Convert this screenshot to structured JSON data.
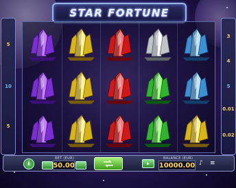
{
  "game": {
    "title": "STAR FORTUNE"
  },
  "paylines": {
    "left": [
      "5",
      "10",
      "5"
    ],
    "right": [
      "3",
      "4",
      "5",
      "0.01",
      "0.02"
    ]
  },
  "reels": [
    [
      "purple-crystal",
      "purple-crystal",
      "purple-crystal"
    ],
    [
      "yellow-crystal",
      "yellow-crystal",
      "yellow-crystal"
    ],
    [
      "red-crystal",
      "red-crystal",
      "red-crystal"
    ],
    [
      "white-crystal",
      "green-crystal",
      "green-crystal"
    ],
    [
      "blue-crystal",
      "blue-crystal",
      "yellow-crystal"
    ]
  ],
  "crystal_colors": {
    "purple-crystal": {
      "light": "#c77dff",
      "mid": "#7b2fd0",
      "dark": "#3e0e7a"
    },
    "yellow-crystal": {
      "light": "#fff38a",
      "mid": "#d6b41a",
      "dark": "#7a5c06"
    },
    "red-crystal": {
      "light": "#ff7a7a",
      "mid": "#d01818",
      "dark": "#6a0606"
    },
    "white-crystal": {
      "light": "#ffffff",
      "mid": "#bfc4c8",
      "dark": "#5f6468"
    },
    "green-crystal": {
      "light": "#a8ff8a",
      "mid": "#2fb52f",
      "dark": "#0d5a12"
    },
    "blue-crystal": {
      "light": "#b8e4ff",
      "mid": "#3c8fd0",
      "dark": "#13406e"
    }
  },
  "controls": {
    "info_label": "i",
    "bet_label": "BET (EUR)",
    "bet_value": "50.00",
    "balance_label": "BALANCE (EUR)",
    "balance_value": "10000.00"
  }
}
